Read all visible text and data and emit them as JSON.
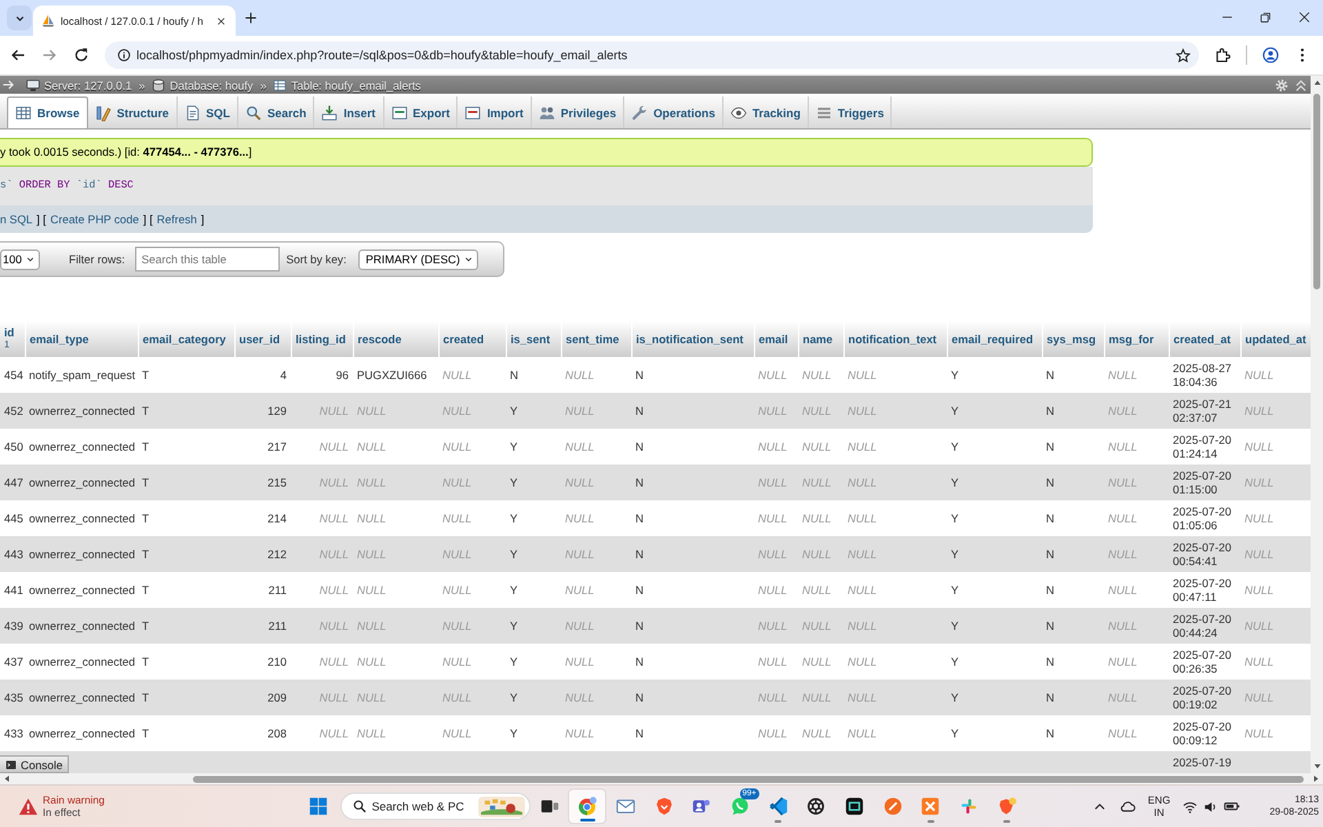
{
  "browser": {
    "tab_title": "localhost / 127.0.0.1 / houfy / h",
    "url": "localhost/phpmyadmin/index.php?route=/sql&pos=0&db=houfy&table=houfy_email_alerts"
  },
  "breadcrumb": [
    {
      "kind": "server",
      "label": "Server: 127.0.0.1"
    },
    {
      "kind": "separator",
      "label": "»"
    },
    {
      "kind": "database",
      "label": "Database: houfy"
    },
    {
      "kind": "separator",
      "label": "»"
    },
    {
      "kind": "table",
      "label": "Table: houfy_email_alerts"
    }
  ],
  "tabs": [
    {
      "label": "Browse",
      "selected": true
    },
    {
      "label": "Structure",
      "selected": false
    },
    {
      "label": "SQL",
      "selected": false
    },
    {
      "label": "Search",
      "selected": false
    },
    {
      "label": "Insert",
      "selected": false
    },
    {
      "label": "Export",
      "selected": false
    },
    {
      "label": "Import",
      "selected": false
    },
    {
      "label": "Privileges",
      "selected": false
    },
    {
      "label": "Operations",
      "selected": false
    },
    {
      "label": "Tracking",
      "selected": false
    },
    {
      "label": "Triggers",
      "selected": false
    }
  ],
  "message": "y took 0.0015 seconds.) [id: **477454... - 477376...**]",
  "sql_query": [
    {
      "kind": "identifier",
      "text": "s`"
    },
    {
      "kind": "keyword",
      "text": "ORDER BY"
    },
    {
      "kind": "identifier",
      "text": "`id`"
    },
    {
      "kind": "keyword",
      "text": "DESC"
    }
  ],
  "query_links": [
    {
      "kind": "link",
      "text": "n SQL"
    },
    {
      "kind": "text",
      "text": "] ["
    },
    {
      "kind": "link",
      "text": "Create PHP code"
    },
    {
      "kind": "text",
      "text": "] ["
    },
    {
      "kind": "link",
      "text": "Refresh"
    },
    {
      "kind": "text",
      "text": "]"
    }
  ],
  "filter": {
    "rows_per_page": "100",
    "filter_label": "Filter rows:",
    "search_placeholder": "Search this table",
    "sort_label": "Sort by key:",
    "sort_value": "PRIMARY (DESC)"
  },
  "table": {
    "columns": [
      {
        "label": "id",
        "kind": "number",
        "sort_order": "1"
      },
      {
        "label": "email_type",
        "kind": "text"
      },
      {
        "label": "email_category",
        "kind": "text"
      },
      {
        "label": "user_id",
        "kind": "number"
      },
      {
        "label": "listing_id",
        "kind": "number"
      },
      {
        "label": "rescode",
        "kind": "text"
      },
      {
        "label": "created",
        "kind": "text"
      },
      {
        "label": "is_sent",
        "kind": "text"
      },
      {
        "label": "sent_time",
        "kind": "text"
      },
      {
        "label": "is_notification_sent",
        "kind": "text"
      },
      {
        "label": "email",
        "kind": "text"
      },
      {
        "label": "name",
        "kind": "text"
      },
      {
        "label": "notification_text",
        "kind": "text"
      },
      {
        "label": "email_required",
        "kind": "text"
      },
      {
        "label": "sys_msg",
        "kind": "text"
      },
      {
        "label": "msg_for",
        "kind": "text"
      },
      {
        "label": "created_at",
        "kind": "datetime"
      },
      {
        "label": "updated_at",
        "kind": "datetime"
      }
    ],
    "rows": [
      {
        "cells": [
          {
            "text": "454",
            "null": false
          },
          {
            "text": "notify_spam_request",
            "null": false
          },
          {
            "text": "T",
            "null": false
          },
          {
            "text": "4",
            "null": false
          },
          {
            "text": "96",
            "null": false
          },
          {
            "text": "PUGXZUI666",
            "null": false
          },
          {
            "text": "NULL",
            "null": true
          },
          {
            "text": "N",
            "null": false
          },
          {
            "text": "NULL",
            "null": true
          },
          {
            "text": "N",
            "null": false
          },
          {
            "text": "NULL",
            "null": true
          },
          {
            "text": "NULL",
            "null": true
          },
          {
            "text": "NULL",
            "null": true
          },
          {
            "text": "Y",
            "null": false
          },
          {
            "text": "N",
            "null": false
          },
          {
            "text": "NULL",
            "null": true
          },
          {
            "text": "2025-08-27 18:04:36",
            "null": false
          },
          {
            "text": "NULL",
            "null": true
          }
        ]
      },
      {
        "cells": [
          {
            "text": "452",
            "null": false
          },
          {
            "text": "ownerrez_connected",
            "null": false
          },
          {
            "text": "T",
            "null": false
          },
          {
            "text": "129",
            "null": false
          },
          {
            "text": "NULL",
            "null": true
          },
          {
            "text": "NULL",
            "null": true
          },
          {
            "text": "NULL",
            "null": true
          },
          {
            "text": "Y",
            "null": false
          },
          {
            "text": "NULL",
            "null": true
          },
          {
            "text": "N",
            "null": false
          },
          {
            "text": "NULL",
            "null": true
          },
          {
            "text": "NULL",
            "null": true
          },
          {
            "text": "NULL",
            "null": true
          },
          {
            "text": "Y",
            "null": false
          },
          {
            "text": "N",
            "null": false
          },
          {
            "text": "NULL",
            "null": true
          },
          {
            "text": "2025-07-21 02:37:07",
            "null": false
          },
          {
            "text": "NULL",
            "null": true
          }
        ]
      },
      {
        "cells": [
          {
            "text": "450",
            "null": false
          },
          {
            "text": "ownerrez_connected",
            "null": false
          },
          {
            "text": "T",
            "null": false
          },
          {
            "text": "217",
            "null": false
          },
          {
            "text": "NULL",
            "null": true
          },
          {
            "text": "NULL",
            "null": true
          },
          {
            "text": "NULL",
            "null": true
          },
          {
            "text": "Y",
            "null": false
          },
          {
            "text": "NULL",
            "null": true
          },
          {
            "text": "N",
            "null": false
          },
          {
            "text": "NULL",
            "null": true
          },
          {
            "text": "NULL",
            "null": true
          },
          {
            "text": "NULL",
            "null": true
          },
          {
            "text": "Y",
            "null": false
          },
          {
            "text": "N",
            "null": false
          },
          {
            "text": "NULL",
            "null": true
          },
          {
            "text": "2025-07-20 01:24:14",
            "null": false
          },
          {
            "text": "NULL",
            "null": true
          }
        ]
      },
      {
        "cells": [
          {
            "text": "447",
            "null": false
          },
          {
            "text": "ownerrez_connected",
            "null": false
          },
          {
            "text": "T",
            "null": false
          },
          {
            "text": "215",
            "null": false
          },
          {
            "text": "NULL",
            "null": true
          },
          {
            "text": "NULL",
            "null": true
          },
          {
            "text": "NULL",
            "null": true
          },
          {
            "text": "Y",
            "null": false
          },
          {
            "text": "NULL",
            "null": true
          },
          {
            "text": "N",
            "null": false
          },
          {
            "text": "NULL",
            "null": true
          },
          {
            "text": "NULL",
            "null": true
          },
          {
            "text": "NULL",
            "null": true
          },
          {
            "text": "Y",
            "null": false
          },
          {
            "text": "N",
            "null": false
          },
          {
            "text": "NULL",
            "null": true
          },
          {
            "text": "2025-07-20 01:15:00",
            "null": false
          },
          {
            "text": "NULL",
            "null": true
          }
        ]
      },
      {
        "cells": [
          {
            "text": "445",
            "null": false
          },
          {
            "text": "ownerrez_connected",
            "null": false
          },
          {
            "text": "T",
            "null": false
          },
          {
            "text": "214",
            "null": false
          },
          {
            "text": "NULL",
            "null": true
          },
          {
            "text": "NULL",
            "null": true
          },
          {
            "text": "NULL",
            "null": true
          },
          {
            "text": "Y",
            "null": false
          },
          {
            "text": "NULL",
            "null": true
          },
          {
            "text": "N",
            "null": false
          },
          {
            "text": "NULL",
            "null": true
          },
          {
            "text": "NULL",
            "null": true
          },
          {
            "text": "NULL",
            "null": true
          },
          {
            "text": "Y",
            "null": false
          },
          {
            "text": "N",
            "null": false
          },
          {
            "text": "NULL",
            "null": true
          },
          {
            "text": "2025-07-20 01:05:06",
            "null": false
          },
          {
            "text": "NULL",
            "null": true
          }
        ]
      },
      {
        "cells": [
          {
            "text": "443",
            "null": false
          },
          {
            "text": "ownerrez_connected",
            "null": false
          },
          {
            "text": "T",
            "null": false
          },
          {
            "text": "212",
            "null": false
          },
          {
            "text": "NULL",
            "null": true
          },
          {
            "text": "NULL",
            "null": true
          },
          {
            "text": "NULL",
            "null": true
          },
          {
            "text": "Y",
            "null": false
          },
          {
            "text": "NULL",
            "null": true
          },
          {
            "text": "N",
            "null": false
          },
          {
            "text": "NULL",
            "null": true
          },
          {
            "text": "NULL",
            "null": true
          },
          {
            "text": "NULL",
            "null": true
          },
          {
            "text": "Y",
            "null": false
          },
          {
            "text": "N",
            "null": false
          },
          {
            "text": "NULL",
            "null": true
          },
          {
            "text": "2025-07-20 00:54:41",
            "null": false
          },
          {
            "text": "NULL",
            "null": true
          }
        ]
      },
      {
        "cells": [
          {
            "text": "441",
            "null": false
          },
          {
            "text": "ownerrez_connected",
            "null": false
          },
          {
            "text": "T",
            "null": false
          },
          {
            "text": "211",
            "null": false
          },
          {
            "text": "NULL",
            "null": true
          },
          {
            "text": "NULL",
            "null": true
          },
          {
            "text": "NULL",
            "null": true
          },
          {
            "text": "Y",
            "null": false
          },
          {
            "text": "NULL",
            "null": true
          },
          {
            "text": "N",
            "null": false
          },
          {
            "text": "NULL",
            "null": true
          },
          {
            "text": "NULL",
            "null": true
          },
          {
            "text": "NULL",
            "null": true
          },
          {
            "text": "Y",
            "null": false
          },
          {
            "text": "N",
            "null": false
          },
          {
            "text": "NULL",
            "null": true
          },
          {
            "text": "2025-07-20 00:47:11",
            "null": false
          },
          {
            "text": "NULL",
            "null": true
          }
        ]
      },
      {
        "cells": [
          {
            "text": "439",
            "null": false
          },
          {
            "text": "ownerrez_connected",
            "null": false
          },
          {
            "text": "T",
            "null": false
          },
          {
            "text": "211",
            "null": false
          },
          {
            "text": "NULL",
            "null": true
          },
          {
            "text": "NULL",
            "null": true
          },
          {
            "text": "NULL",
            "null": true
          },
          {
            "text": "Y",
            "null": false
          },
          {
            "text": "NULL",
            "null": true
          },
          {
            "text": "N",
            "null": false
          },
          {
            "text": "NULL",
            "null": true
          },
          {
            "text": "NULL",
            "null": true
          },
          {
            "text": "NULL",
            "null": true
          },
          {
            "text": "Y",
            "null": false
          },
          {
            "text": "N",
            "null": false
          },
          {
            "text": "NULL",
            "null": true
          },
          {
            "text": "2025-07-20 00:44:24",
            "null": false
          },
          {
            "text": "NULL",
            "null": true
          }
        ]
      },
      {
        "cells": [
          {
            "text": "437",
            "null": false
          },
          {
            "text": "ownerrez_connected",
            "null": false
          },
          {
            "text": "T",
            "null": false
          },
          {
            "text": "210",
            "null": false
          },
          {
            "text": "NULL",
            "null": true
          },
          {
            "text": "NULL",
            "null": true
          },
          {
            "text": "NULL",
            "null": true
          },
          {
            "text": "Y",
            "null": false
          },
          {
            "text": "NULL",
            "null": true
          },
          {
            "text": "N",
            "null": false
          },
          {
            "text": "NULL",
            "null": true
          },
          {
            "text": "NULL",
            "null": true
          },
          {
            "text": "NULL",
            "null": true
          },
          {
            "text": "Y",
            "null": false
          },
          {
            "text": "N",
            "null": false
          },
          {
            "text": "NULL",
            "null": true
          },
          {
            "text": "2025-07-20 00:26:35",
            "null": false
          },
          {
            "text": "NULL",
            "null": true
          }
        ]
      },
      {
        "cells": [
          {
            "text": "435",
            "null": false
          },
          {
            "text": "ownerrez_connected",
            "null": false
          },
          {
            "text": "T",
            "null": false
          },
          {
            "text": "209",
            "null": false
          },
          {
            "text": "NULL",
            "null": true
          },
          {
            "text": "NULL",
            "null": true
          },
          {
            "text": "NULL",
            "null": true
          },
          {
            "text": "Y",
            "null": false
          },
          {
            "text": "NULL",
            "null": true
          },
          {
            "text": "N",
            "null": false
          },
          {
            "text": "NULL",
            "null": true
          },
          {
            "text": "NULL",
            "null": true
          },
          {
            "text": "NULL",
            "null": true
          },
          {
            "text": "Y",
            "null": false
          },
          {
            "text": "N",
            "null": false
          },
          {
            "text": "NULL",
            "null": true
          },
          {
            "text": "2025-07-20 00:19:02",
            "null": false
          },
          {
            "text": "NULL",
            "null": true
          }
        ]
      },
      {
        "cells": [
          {
            "text": "433",
            "null": false
          },
          {
            "text": "ownerrez_connected",
            "null": false
          },
          {
            "text": "T",
            "null": false
          },
          {
            "text": "208",
            "null": false
          },
          {
            "text": "NULL",
            "null": true
          },
          {
            "text": "NULL",
            "null": true
          },
          {
            "text": "NULL",
            "null": true
          },
          {
            "text": "Y",
            "null": false
          },
          {
            "text": "NULL",
            "null": true
          },
          {
            "text": "N",
            "null": false
          },
          {
            "text": "NULL",
            "null": true
          },
          {
            "text": "NULL",
            "null": true
          },
          {
            "text": "NULL",
            "null": true
          },
          {
            "text": "Y",
            "null": false
          },
          {
            "text": "N",
            "null": false
          },
          {
            "text": "NULL",
            "null": true
          },
          {
            "text": "2025-07-20 00:09:12",
            "null": false
          },
          {
            "text": "NULL",
            "null": true
          }
        ]
      }
    ],
    "partial_row": {
      "created_at": "2025-07-19"
    }
  },
  "console_button": "Console",
  "taskbar": {
    "weather": {
      "title": "Rain warning",
      "subtitle": "In effect"
    },
    "search": {
      "placeholder": "Search web & PC"
    },
    "apps": [
      {
        "selected": true,
        "running": true
      },
      {
        "selected": false,
        "running": false
      },
      {
        "selected": false,
        "running": false
      },
      {
        "selected": false,
        "running": false
      },
      {
        "selected": false,
        "running": false,
        "badge": "99+"
      },
      {
        "selected": false,
        "running": true
      },
      {
        "selected": false,
        "running": false
      },
      {
        "selected": false,
        "running": false
      },
      {
        "selected": false,
        "running": false
      },
      {
        "selected": false,
        "running": true
      },
      {
        "selected": false,
        "running": false
      },
      {
        "selected": false,
        "running": true
      }
    ],
    "language": {
      "code": "ENG",
      "region": "IN"
    },
    "clock": {
      "time": "18:13",
      "date": "29-08-2025"
    }
  }
}
